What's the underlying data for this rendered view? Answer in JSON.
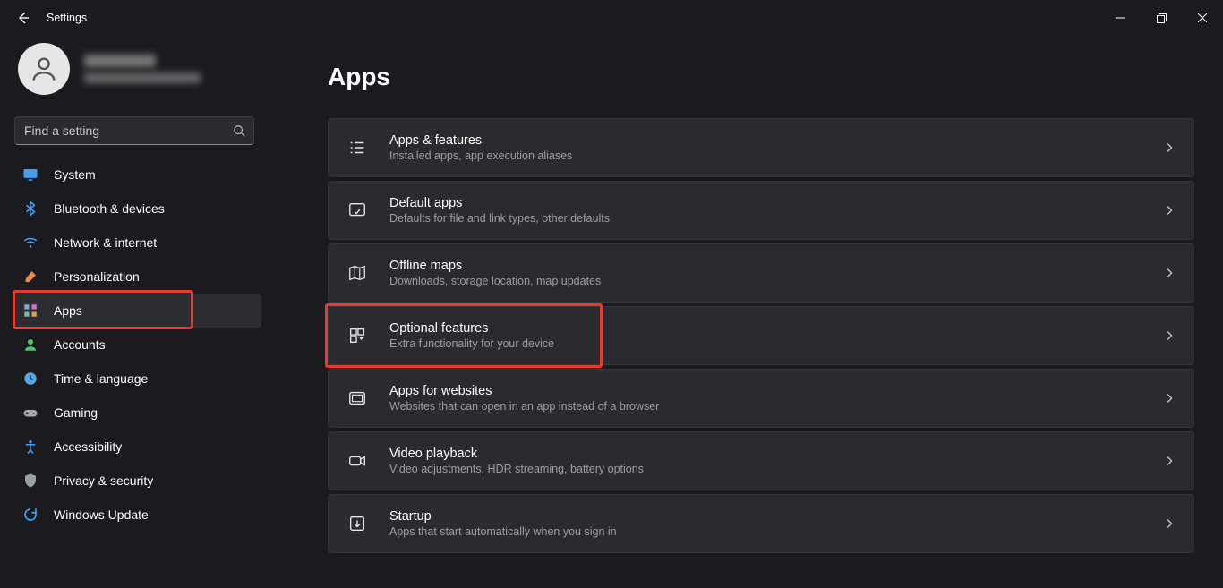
{
  "window": {
    "title": "Settings"
  },
  "search": {
    "placeholder": "Find a setting"
  },
  "main": {
    "heading": "Apps"
  },
  "sidebar": {
    "items": [
      {
        "id": "system",
        "label": "System",
        "icon": "monitor",
        "color": "#45a0f5"
      },
      {
        "id": "bluetooth",
        "label": "Bluetooth & devices",
        "icon": "bluetooth",
        "color": "#45a0f5"
      },
      {
        "id": "network",
        "label": "Network & internet",
        "icon": "wifi",
        "color": "#45a0f5"
      },
      {
        "id": "personalization",
        "label": "Personalization",
        "icon": "brush",
        "color": "#e98f4b"
      },
      {
        "id": "apps",
        "label": "Apps",
        "icon": "apps",
        "color": "#7ea6d6",
        "active": true,
        "highlight": true
      },
      {
        "id": "accounts",
        "label": "Accounts",
        "icon": "person",
        "color": "#53c66d"
      },
      {
        "id": "time",
        "label": "Time & language",
        "icon": "clock",
        "color": "#5aa8e0"
      },
      {
        "id": "gaming",
        "label": "Gaming",
        "icon": "gamepad",
        "color": "#a8a8b0"
      },
      {
        "id": "accessibility",
        "label": "Accessibility",
        "icon": "access",
        "color": "#45a0f5"
      },
      {
        "id": "privacy",
        "label": "Privacy & security",
        "icon": "shield",
        "color": "#9aa0a6"
      },
      {
        "id": "update",
        "label": "Windows Update",
        "icon": "update",
        "color": "#45a0f5"
      }
    ]
  },
  "cards": [
    {
      "id": "apps-features",
      "title": "Apps & features",
      "sub": "Installed apps, app execution aliases",
      "icon": "list"
    },
    {
      "id": "default-apps",
      "title": "Default apps",
      "sub": "Defaults for file and link types, other defaults",
      "icon": "default"
    },
    {
      "id": "offline-maps",
      "title": "Offline maps",
      "sub": "Downloads, storage location, map updates",
      "icon": "map"
    },
    {
      "id": "optional-features",
      "title": "Optional features",
      "sub": "Extra functionality for your device",
      "icon": "puzzle",
      "highlight": true
    },
    {
      "id": "apps-websites",
      "title": "Apps for websites",
      "sub": "Websites that can open in an app instead of a browser",
      "icon": "globe"
    },
    {
      "id": "video-playback",
      "title": "Video playback",
      "sub": "Video adjustments, HDR streaming, battery options",
      "icon": "video"
    },
    {
      "id": "startup",
      "title": "Startup",
      "sub": "Apps that start automatically when you sign in",
      "icon": "startup"
    }
  ]
}
